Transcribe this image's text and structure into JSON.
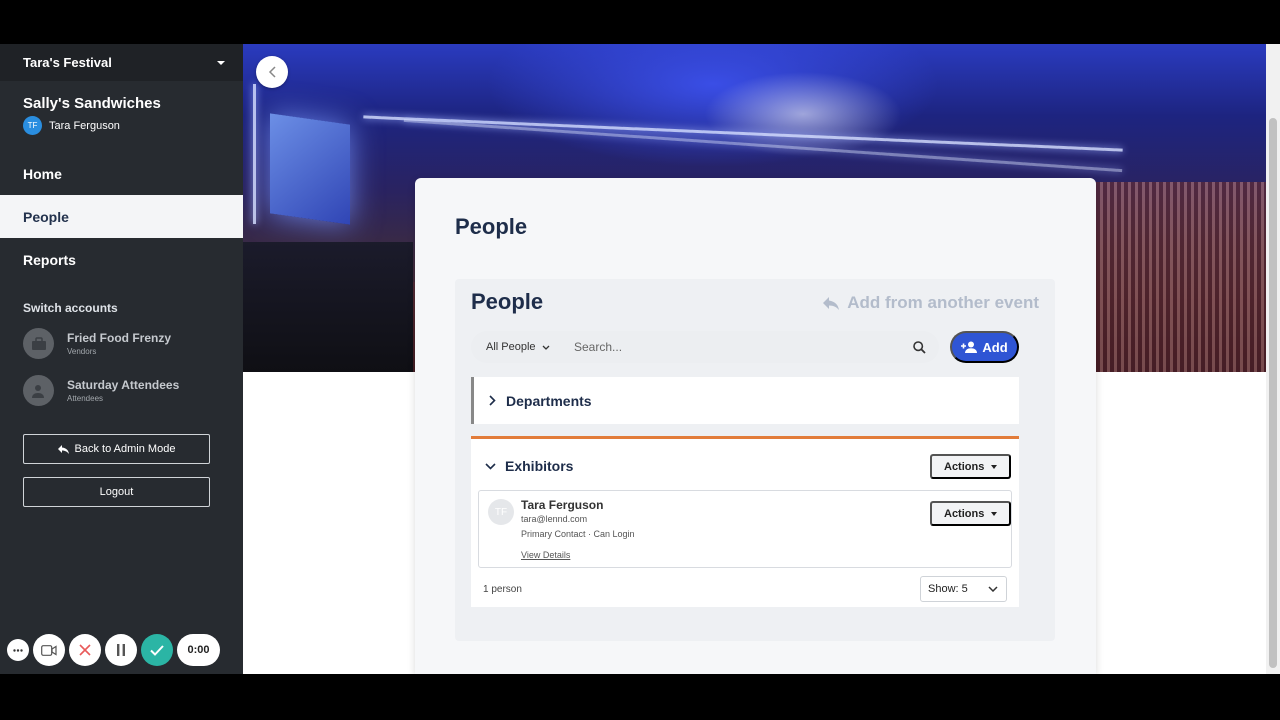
{
  "sidebar": {
    "event_name": "Tara's Festival",
    "account_name": "Sally's Sandwiches",
    "user": {
      "initials": "TF",
      "name": "Tara Ferguson"
    },
    "nav": [
      {
        "label": "Home",
        "active": false
      },
      {
        "label": "People",
        "active": true
      },
      {
        "label": "Reports",
        "active": false
      }
    ],
    "switch_title": "Switch accounts",
    "switch_accounts": [
      {
        "name": "Fried Food Frenzy",
        "type": "Vendors",
        "icon": "briefcase-icon"
      },
      {
        "name": "Saturday Attendees",
        "type": "Attendees",
        "icon": "user-check-icon"
      }
    ],
    "back_admin_label": "Back to Admin Mode",
    "logout_label": "Logout"
  },
  "recorder": {
    "timer": "0:00"
  },
  "page": {
    "title": "People",
    "panel_title": "People",
    "add_from_other": "Add from another event",
    "filter_value": "All People",
    "search_placeholder": "Search...",
    "add_label": "Add",
    "departments_label": "Departments",
    "exhibitors_label": "Exhibitors",
    "actions_label": "Actions",
    "person": {
      "initials": "TF",
      "name": "Tara Ferguson",
      "email": "tara@lennd.com",
      "meta": "Primary Contact · Can Login",
      "view_details": "View Details",
      "actions_label": "Actions"
    },
    "count_text": "1 person",
    "show_value": "Show: 5"
  },
  "colors": {
    "sidebar_bg": "#272b30",
    "accent_blue": "#2f55d4",
    "exhibitor_accent": "#e27c3a",
    "title_navy": "#1e2d4a"
  }
}
